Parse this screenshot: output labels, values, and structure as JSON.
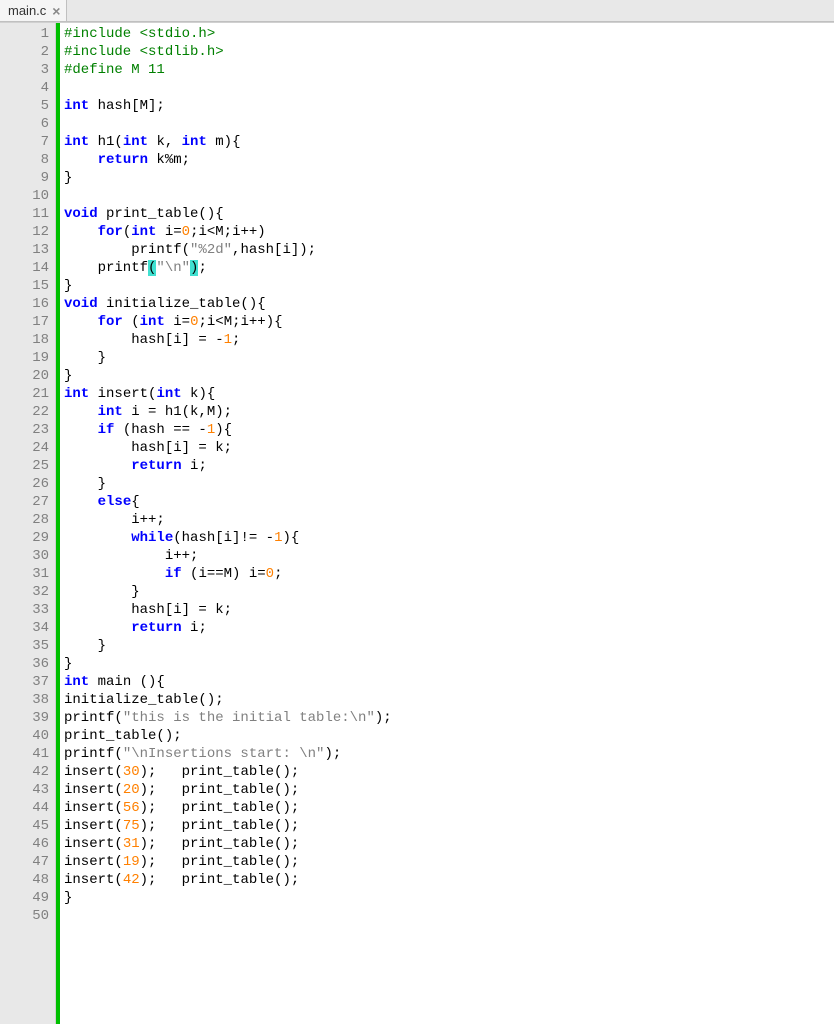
{
  "tab": {
    "filename": "main.c",
    "close_glyph": "×"
  },
  "line_count": 50,
  "code_lines": [
    {
      "n": 1,
      "tokens": [
        {
          "t": "#include <stdio.h>",
          "c": "pp"
        }
      ]
    },
    {
      "n": 2,
      "tokens": [
        {
          "t": "#include <stdlib.h>",
          "c": "pp"
        }
      ]
    },
    {
      "n": 3,
      "tokens": [
        {
          "t": "#define M 11",
          "c": "pp"
        }
      ]
    },
    {
      "n": 4,
      "tokens": []
    },
    {
      "n": 5,
      "tokens": [
        {
          "t": "int",
          "c": "kw"
        },
        {
          "t": " hash[M];",
          "c": "id"
        }
      ]
    },
    {
      "n": 6,
      "tokens": []
    },
    {
      "n": 7,
      "fold": "-",
      "tokens": [
        {
          "t": "int",
          "c": "kw"
        },
        {
          "t": " h1(",
          "c": "id"
        },
        {
          "t": "int",
          "c": "kw"
        },
        {
          "t": " k, ",
          "c": "id"
        },
        {
          "t": "int",
          "c": "kw"
        },
        {
          "t": " m){",
          "c": "id"
        }
      ]
    },
    {
      "n": 8,
      "tokens": [
        {
          "t": "    ",
          "c": "id"
        },
        {
          "t": "return",
          "c": "kw"
        },
        {
          "t": " k%m;",
          "c": "id"
        }
      ]
    },
    {
      "n": 9,
      "tokens": [
        {
          "t": "}",
          "c": "id"
        }
      ]
    },
    {
      "n": 10,
      "tokens": []
    },
    {
      "n": 11,
      "fold": "-",
      "tokens": [
        {
          "t": "void",
          "c": "kw"
        },
        {
          "t": " print_table(){",
          "c": "id"
        }
      ]
    },
    {
      "n": 12,
      "tokens": [
        {
          "t": "    ",
          "c": "id"
        },
        {
          "t": "for",
          "c": "kw"
        },
        {
          "t": "(",
          "c": "id"
        },
        {
          "t": "int",
          "c": "kw"
        },
        {
          "t": " i=",
          "c": "id"
        },
        {
          "t": "0",
          "c": "num"
        },
        {
          "t": ";i<M;i++)",
          "c": "id"
        }
      ]
    },
    {
      "n": 13,
      "tokens": [
        {
          "t": "        printf(",
          "c": "id"
        },
        {
          "t": "\"%2d\"",
          "c": "str"
        },
        {
          "t": ",hash[i]);",
          "c": "id"
        }
      ]
    },
    {
      "n": 14,
      "tokens": [
        {
          "t": "    printf",
          "c": "id"
        },
        {
          "t": "(",
          "c": "hl"
        },
        {
          "t": "\"\\n\"",
          "c": "str"
        },
        {
          "t": ")",
          "c": "hl"
        },
        {
          "t": ";",
          "c": "id"
        }
      ]
    },
    {
      "n": 15,
      "tokens": [
        {
          "t": "}",
          "c": "id"
        }
      ]
    },
    {
      "n": 16,
      "fold": "-",
      "tokens": [
        {
          "t": "void",
          "c": "kw"
        },
        {
          "t": " initialize_table(){",
          "c": "id"
        }
      ]
    },
    {
      "n": 17,
      "fold": "-",
      "tokens": [
        {
          "t": "    ",
          "c": "id"
        },
        {
          "t": "for",
          "c": "kw"
        },
        {
          "t": " (",
          "c": "id"
        },
        {
          "t": "int",
          "c": "kw"
        },
        {
          "t": " i=",
          "c": "id"
        },
        {
          "t": "0",
          "c": "num"
        },
        {
          "t": ";i<M;i++){",
          "c": "id"
        }
      ]
    },
    {
      "n": 18,
      "tokens": [
        {
          "t": "        hash[i] = -",
          "c": "id"
        },
        {
          "t": "1",
          "c": "num"
        },
        {
          "t": ";",
          "c": "id"
        }
      ]
    },
    {
      "n": 19,
      "tokens": [
        {
          "t": "    }",
          "c": "id"
        }
      ]
    },
    {
      "n": 20,
      "tokens": [
        {
          "t": "}",
          "c": "id"
        }
      ]
    },
    {
      "n": 21,
      "fold": "-",
      "tokens": [
        {
          "t": "int",
          "c": "kw"
        },
        {
          "t": " insert(",
          "c": "id"
        },
        {
          "t": "int",
          "c": "kw"
        },
        {
          "t": " k){",
          "c": "id"
        }
      ]
    },
    {
      "n": 22,
      "tokens": [
        {
          "t": "    ",
          "c": "id"
        },
        {
          "t": "int",
          "c": "kw"
        },
        {
          "t": " i = h1(k,M);",
          "c": "id"
        }
      ]
    },
    {
      "n": 23,
      "fold": "-",
      "tokens": [
        {
          "t": "    ",
          "c": "id"
        },
        {
          "t": "if",
          "c": "kw"
        },
        {
          "t": " (hash == -",
          "c": "id"
        },
        {
          "t": "1",
          "c": "num"
        },
        {
          "t": "){",
          "c": "id"
        }
      ]
    },
    {
      "n": 24,
      "tokens": [
        {
          "t": "        hash[i] = k;",
          "c": "id"
        }
      ]
    },
    {
      "n": 25,
      "tokens": [
        {
          "t": "        ",
          "c": "id"
        },
        {
          "t": "return",
          "c": "kw"
        },
        {
          "t": " i;",
          "c": "id"
        }
      ]
    },
    {
      "n": 26,
      "tokens": [
        {
          "t": "    }",
          "c": "id"
        }
      ]
    },
    {
      "n": 27,
      "fold": "-",
      "tokens": [
        {
          "t": "    ",
          "c": "id"
        },
        {
          "t": "else",
          "c": "kw"
        },
        {
          "t": "{",
          "c": "id"
        }
      ]
    },
    {
      "n": 28,
      "tokens": [
        {
          "t": "        i++;",
          "c": "id"
        }
      ]
    },
    {
      "n": 29,
      "fold": "-",
      "tokens": [
        {
          "t": "        ",
          "c": "id"
        },
        {
          "t": "while",
          "c": "kw"
        },
        {
          "t": "(hash[i]!= -",
          "c": "id"
        },
        {
          "t": "1",
          "c": "num"
        },
        {
          "t": "){",
          "c": "id"
        }
      ]
    },
    {
      "n": 30,
      "tokens": [
        {
          "t": "            i++;",
          "c": "id"
        }
      ]
    },
    {
      "n": 31,
      "tokens": [
        {
          "t": "            ",
          "c": "id"
        },
        {
          "t": "if",
          "c": "kw"
        },
        {
          "t": " (i==M) i=",
          "c": "id"
        },
        {
          "t": "0",
          "c": "num"
        },
        {
          "t": ";",
          "c": "id"
        }
      ]
    },
    {
      "n": 32,
      "tokens": [
        {
          "t": "        }",
          "c": "id"
        }
      ]
    },
    {
      "n": 33,
      "tokens": [
        {
          "t": "        hash[i] = k;",
          "c": "id"
        }
      ]
    },
    {
      "n": 34,
      "tokens": [
        {
          "t": "        ",
          "c": "id"
        },
        {
          "t": "return",
          "c": "kw"
        },
        {
          "t": " i;",
          "c": "id"
        }
      ]
    },
    {
      "n": 35,
      "tokens": [
        {
          "t": "    }",
          "c": "id"
        }
      ]
    },
    {
      "n": 36,
      "tokens": [
        {
          "t": "}",
          "c": "id"
        }
      ]
    },
    {
      "n": 37,
      "fold": "-",
      "tokens": [
        {
          "t": "int",
          "c": "kw"
        },
        {
          "t": " main (){",
          "c": "id"
        }
      ]
    },
    {
      "n": 38,
      "tokens": [
        {
          "t": "initialize_table();",
          "c": "id"
        }
      ]
    },
    {
      "n": 39,
      "tokens": [
        {
          "t": "printf(",
          "c": "id"
        },
        {
          "t": "\"this is the initial table:\\n\"",
          "c": "str"
        },
        {
          "t": ");",
          "c": "id"
        }
      ]
    },
    {
      "n": 40,
      "tokens": [
        {
          "t": "print_table();",
          "c": "id"
        }
      ]
    },
    {
      "n": 41,
      "tokens": [
        {
          "t": "printf(",
          "c": "id"
        },
        {
          "t": "\"\\nInsertions start: \\n\"",
          "c": "str"
        },
        {
          "t": ");",
          "c": "id"
        }
      ]
    },
    {
      "n": 42,
      "tokens": [
        {
          "t": "insert(",
          "c": "id"
        },
        {
          "t": "30",
          "c": "num"
        },
        {
          "t": ");   print_table();",
          "c": "id"
        }
      ]
    },
    {
      "n": 43,
      "tokens": [
        {
          "t": "insert(",
          "c": "id"
        },
        {
          "t": "20",
          "c": "num"
        },
        {
          "t": ");   print_table();",
          "c": "id"
        }
      ]
    },
    {
      "n": 44,
      "tokens": [
        {
          "t": "insert(",
          "c": "id"
        },
        {
          "t": "56",
          "c": "num"
        },
        {
          "t": ");   print_table();",
          "c": "id"
        }
      ]
    },
    {
      "n": 45,
      "tokens": [
        {
          "t": "insert(",
          "c": "id"
        },
        {
          "t": "75",
          "c": "num"
        },
        {
          "t": ");   print_table();",
          "c": "id"
        }
      ]
    },
    {
      "n": 46,
      "tokens": [
        {
          "t": "insert(",
          "c": "id"
        },
        {
          "t": "31",
          "c": "num"
        },
        {
          "t": ");   print_table();",
          "c": "id"
        }
      ]
    },
    {
      "n": 47,
      "tokens": [
        {
          "t": "insert(",
          "c": "id"
        },
        {
          "t": "19",
          "c": "num"
        },
        {
          "t": ");   print_table();",
          "c": "id"
        }
      ]
    },
    {
      "n": 48,
      "tokens": [
        {
          "t": "insert(",
          "c": "id"
        },
        {
          "t": "42",
          "c": "num"
        },
        {
          "t": ");   print_table();",
          "c": "id"
        }
      ]
    },
    {
      "n": 49,
      "tokens": [
        {
          "t": "}",
          "c": "id"
        }
      ]
    },
    {
      "n": 50,
      "tokens": []
    }
  ]
}
